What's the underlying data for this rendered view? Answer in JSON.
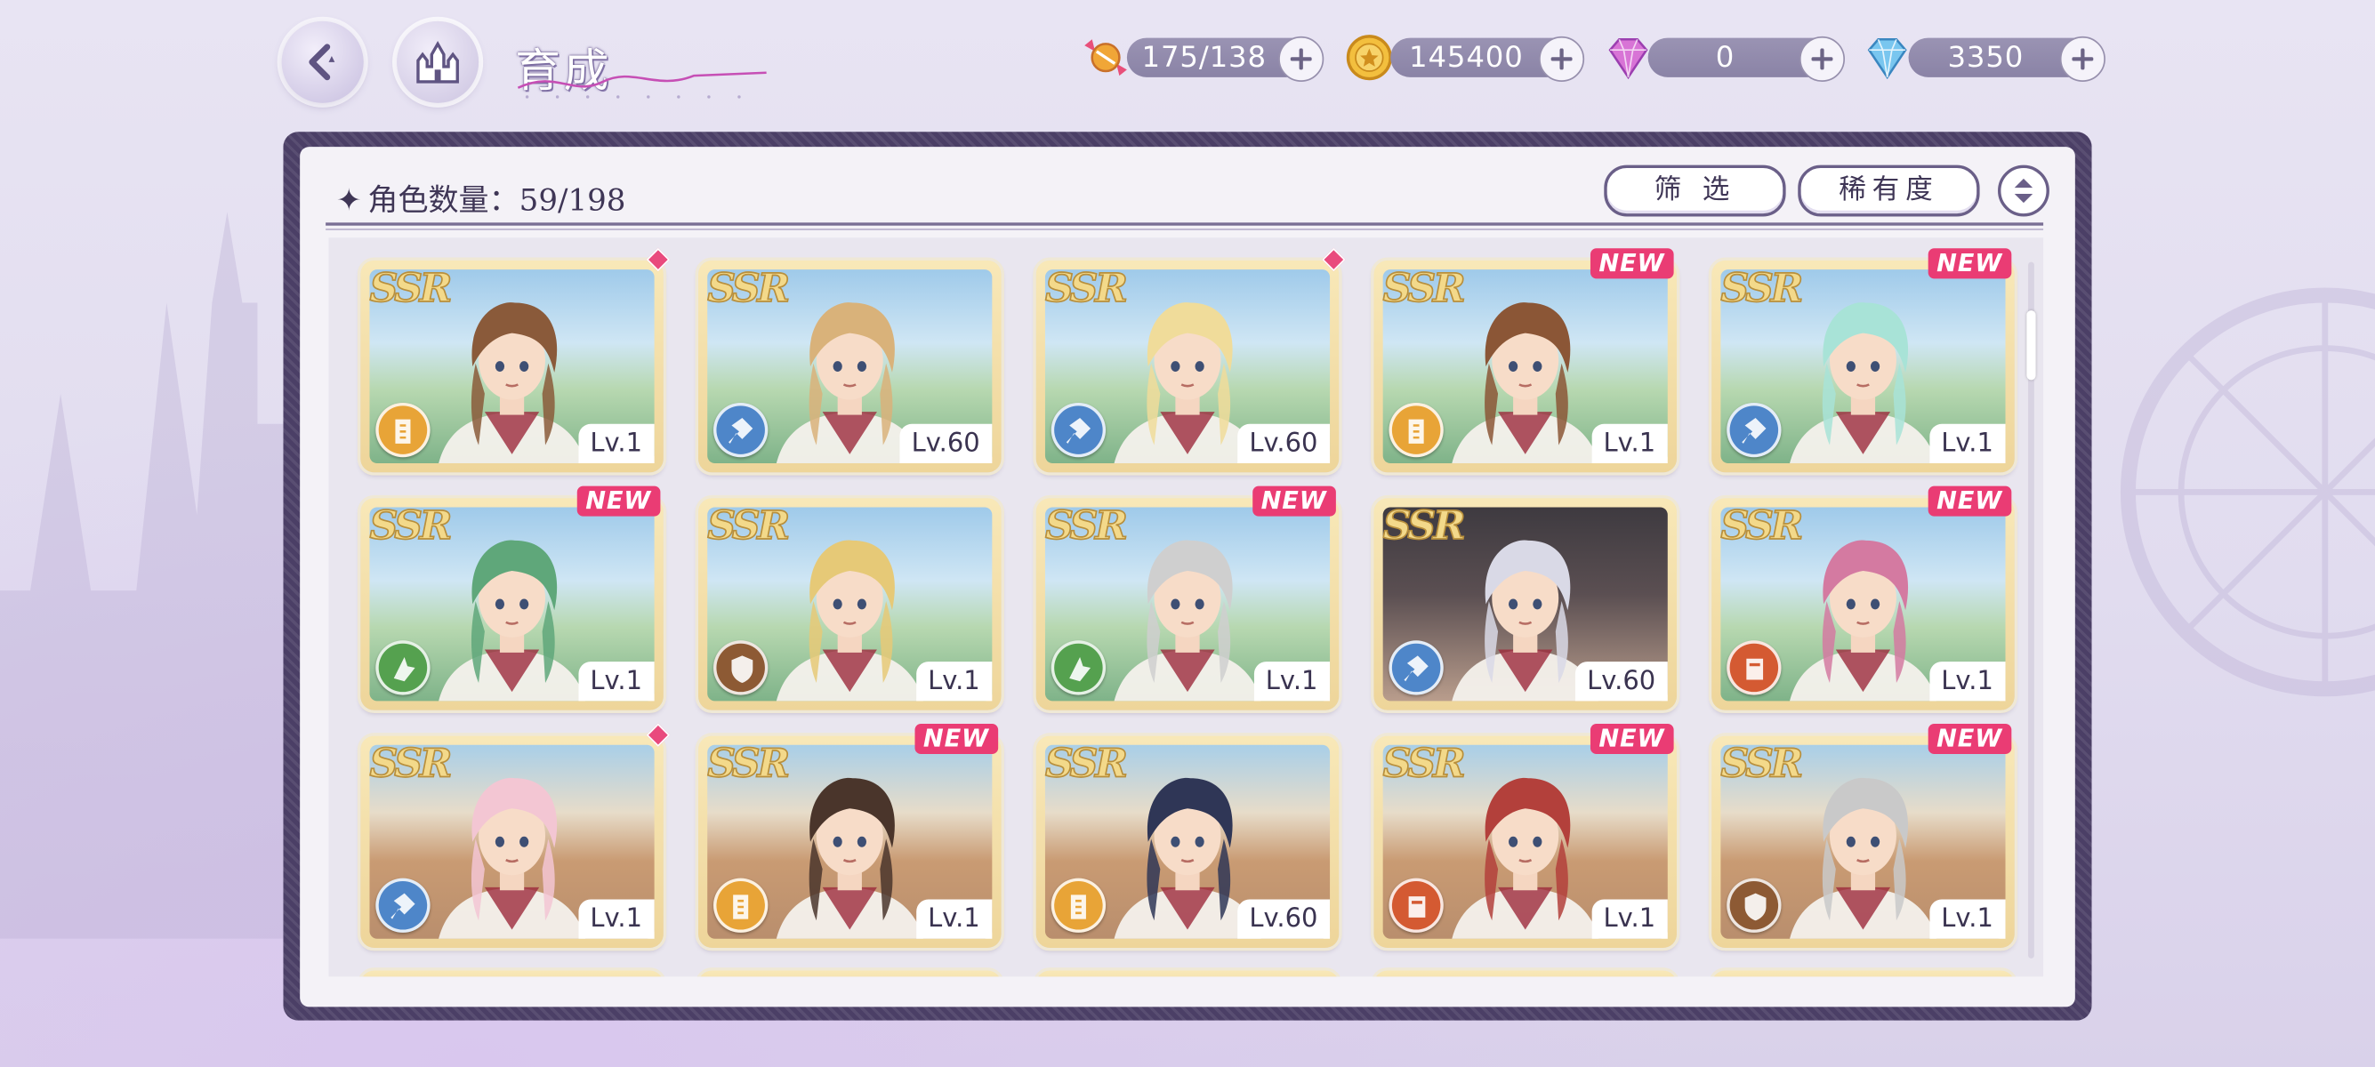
{
  "header": {
    "title": "育成",
    "resources": [
      {
        "name": "candy",
        "value": "175/138",
        "color": "#e9a23b"
      },
      {
        "name": "gold-coin",
        "value": "145400",
        "color": "#f0b73a"
      },
      {
        "name": "pink-gem",
        "value": "0",
        "color": "#d86ad8"
      },
      {
        "name": "blue-diamond",
        "value": "3350",
        "color": "#6fbbe8"
      }
    ]
  },
  "panel": {
    "count_label": "角色数量：59/198",
    "filter_label": "筛 选",
    "sort_label": "稀有度"
  },
  "cards": [
    {
      "rarity": "SSR",
      "level": "Lv.1",
      "class": "yellow",
      "tag": "gem",
      "bg": "sky",
      "hair": "#8a5a3a"
    },
    {
      "rarity": "SSR",
      "level": "Lv.60",
      "class": "blue",
      "tag": "",
      "bg": "sky",
      "hair": "#d9b27a"
    },
    {
      "rarity": "SSR",
      "level": "Lv.60",
      "class": "blue",
      "tag": "gem",
      "bg": "sky",
      "hair": "#f0dc9a"
    },
    {
      "rarity": "SSR",
      "level": "Lv.1",
      "class": "yellow",
      "tag": "NEW",
      "bg": "sky",
      "hair": "#8b5636"
    },
    {
      "rarity": "SSR",
      "level": "Lv.1",
      "class": "blue",
      "tag": "NEW",
      "bg": "sky",
      "hair": "#a8e3d7"
    },
    {
      "rarity": "SSR",
      "level": "Lv.1",
      "class": "green",
      "tag": "NEW",
      "bg": "sky",
      "hair": "#5fa77a"
    },
    {
      "rarity": "SSR",
      "level": "Lv.1",
      "class": "brown",
      "tag": "",
      "bg": "sky",
      "hair": "#e6c977"
    },
    {
      "rarity": "SSR",
      "level": "Lv.1",
      "class": "green",
      "tag": "NEW",
      "bg": "sky",
      "hair": "#cfcfcf"
    },
    {
      "rarity": "SSR",
      "level": "Lv.60",
      "class": "blue",
      "tag": "",
      "bg": "dark",
      "hair": "#d9d9e6"
    },
    {
      "rarity": "SSR",
      "level": "Lv.1",
      "class": "red",
      "tag": "NEW",
      "bg": "sky",
      "hair": "#d47aa1"
    },
    {
      "rarity": "SSR",
      "level": "Lv.1",
      "class": "blue",
      "tag": "gem",
      "bg": "town",
      "hair": "#f3c6d3"
    },
    {
      "rarity": "SSR",
      "level": "Lv.1",
      "class": "yellow",
      "tag": "NEW",
      "bg": "town",
      "hair": "#4a352b"
    },
    {
      "rarity": "SSR",
      "level": "Lv.60",
      "class": "yellow",
      "tag": "",
      "bg": "town",
      "hair": "#2f3656"
    },
    {
      "rarity": "SSR",
      "level": "Lv.1",
      "class": "red",
      "tag": "NEW",
      "bg": "town",
      "hair": "#b3403b"
    },
    {
      "rarity": "SSR",
      "level": "Lv.1",
      "class": "brown",
      "tag": "NEW",
      "bg": "town",
      "hair": "#c9c9c9"
    }
  ]
}
